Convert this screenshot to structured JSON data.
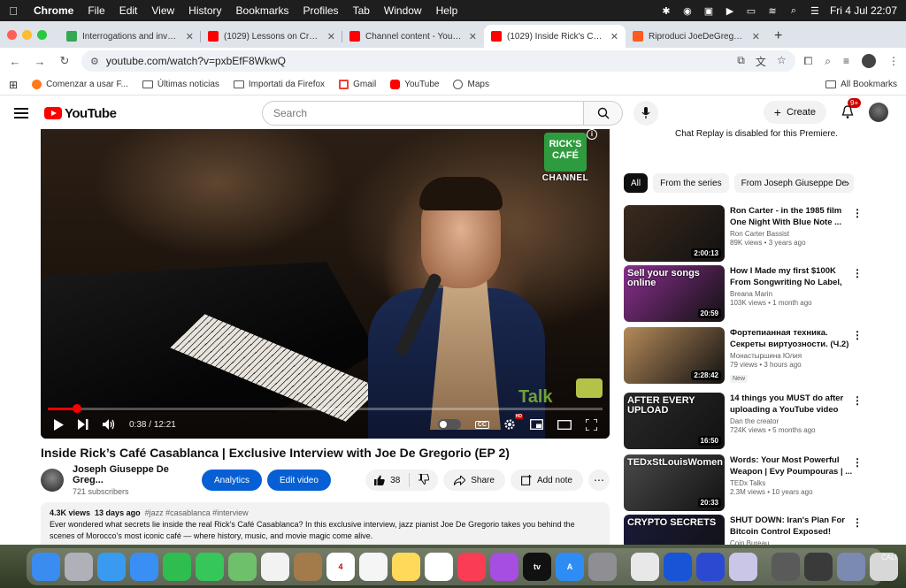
{
  "menubar": {
    "app": "Chrome",
    "items": [
      "File",
      "Edit",
      "View",
      "History",
      "Bookmarks",
      "Profiles",
      "Tab",
      "Window",
      "Help"
    ],
    "clock": "Fri 4 Jul  22:07"
  },
  "tabs": [
    {
      "title": "Interrogations and investigati",
      "favicon_color": "#34a853"
    },
    {
      "title": "(1029) Lessons on Creativity",
      "favicon_color": "#ff0000"
    },
    {
      "title": "Channel content - YouTube St",
      "favicon_color": "#ff0000"
    },
    {
      "title": "(1029) Inside Rick's Café Cas",
      "favicon_color": "#ff0000"
    },
    {
      "title": "Riproduci JoeDeGregorioMus",
      "favicon_color": "#ff5a1f"
    }
  ],
  "omnibox": {
    "url": "youtube.com/watch?v=pxbEfF8WkwQ"
  },
  "bookmarks": [
    {
      "label": "Comenzar a usar F...",
      "type": "firefox"
    },
    {
      "label": "Últimas noticias",
      "type": "folder"
    },
    {
      "label": "Importati da Firefox",
      "type": "folder"
    },
    {
      "label": "Gmail",
      "type": "gmail"
    },
    {
      "label": "YouTube",
      "type": "youtube"
    },
    {
      "label": "Maps",
      "type": "maps"
    }
  ],
  "bookmarks_all": "All Bookmarks",
  "youtube": {
    "logo": "YouTube",
    "search_placeholder": "Search",
    "create_label": "Create",
    "notif_count": "9+"
  },
  "player": {
    "channel_logo_line1": "RICK'S",
    "channel_logo_line2": "CAFÉ",
    "channel_logo_caption": "CHANNEL",
    "time_current": "0:38",
    "time_total": "12:21",
    "progress_fraction": 0.052,
    "talk_text": "Talk",
    "hd_badge": "HD"
  },
  "video": {
    "title": "Inside Rick’s Café Casablanca | Exclusive Interview with Joe De Gregorio (EP 2)",
    "channel": "Joseph Giuseppe De Greg...",
    "subscribers": "721 subscribers",
    "analytics_label": "Analytics",
    "edit_label": "Edit video",
    "likes": "38",
    "share_label": "Share",
    "note_label": "Add note",
    "views": "4.3K views",
    "ago": "13 days ago",
    "tags": "#jazz #casablanca #interview",
    "description_1": "Ever wondered what secrets lie inside the real Rick’s Café Casablanca? In this exclusive interview, jazz pianist Joe De Gregorio takes you behind the",
    "description_2": "scenes of Morocco’s most iconic café — where history, music, and movie magic come alive."
  },
  "sidebar": {
    "chat_note": "Chat Replay is disabled for this Premiere.",
    "chips": [
      "All",
      "From the series",
      "From Joseph Giuseppe De"
    ],
    "recs": [
      {
        "title": "Ron Carter - in the 1985 film One Night With Blue Note ...",
        "channel": "Ron Carter Bassist",
        "meta": "89K views • 3 years ago",
        "duration": "2:00:13",
        "thumb_color": "#3a2a1e",
        "thumb_text": "",
        "new": ""
      },
      {
        "title": "How I Made my first  $100K From Songwriting  No Label, N...",
        "channel": "Breana Marin",
        "meta": "103K views • 1 month ago",
        "duration": "20:59",
        "thumb_color": "#8a2f8f",
        "thumb_text": "Sell your songs online",
        "new": ""
      },
      {
        "title": "Фортепианная техника. Секреты виртуозности. (Ч.2)",
        "channel": "Монастыршина Юлия",
        "meta": "79 views • 3 hours ago",
        "duration": "2:28:42",
        "thumb_color": "#b58a5a",
        "thumb_text": "",
        "new": "New"
      },
      {
        "title": "14 things you MUST do after uploading a YouTube video",
        "channel": "Dan the creator",
        "meta": "724K views • 5 months ago",
        "duration": "16:50",
        "thumb_color": "#2a2a2a",
        "thumb_text": "AFTER EVERY UPLOAD",
        "new": ""
      },
      {
        "title": "Words: Your Most Powerful Weapon | Evy Poumpouras | ...",
        "channel": "TEDx Talks",
        "meta": "2.3M views • 10 years ago",
        "duration": "20:33",
        "thumb_color": "#4a4a4a",
        "thumb_text": "TEDxStLouisWomen",
        "new": ""
      },
      {
        "title": "SHUT DOWN: Iran's Plan For Bitcoin Control Exposed!",
        "channel": "Coin Bureau",
        "meta": "",
        "duration": "",
        "thumb_color": "#1a1a3a",
        "thumb_text": "CRYPTO SECRETS",
        "new": ""
      }
    ]
  },
  "dock": {
    "apps": [
      {
        "name": "finder",
        "color": "#3b8cf0",
        "label": ""
      },
      {
        "name": "launchpad",
        "color": "#b0b0b8",
        "label": ""
      },
      {
        "name": "safari",
        "color": "#3a9af0",
        "label": ""
      },
      {
        "name": "mail",
        "color": "#3a8ff5",
        "label": ""
      },
      {
        "name": "facetime",
        "color": "#2fbd4f",
        "label": ""
      },
      {
        "name": "messages",
        "color": "#35c759",
        "label": ""
      },
      {
        "name": "maps",
        "color": "#6ec16a",
        "label": ""
      },
      {
        "name": "photos",
        "color": "#f2f2f2",
        "label": ""
      },
      {
        "name": "notes-brown",
        "color": "#a37b4a",
        "label": ""
      },
      {
        "name": "calendar",
        "color": "#ffffff",
        "label": "4"
      },
      {
        "name": "reminders",
        "color": "#f5f5f5",
        "label": ""
      },
      {
        "name": "notes",
        "color": "#ffd95a",
        "label": ""
      },
      {
        "name": "freeform",
        "color": "#ffffff",
        "label": ""
      },
      {
        "name": "music",
        "color": "#fa3c55",
        "label": ""
      },
      {
        "name": "podcasts",
        "color": "#a64ee0",
        "label": ""
      },
      {
        "name": "tv",
        "color": "#111111",
        "label": "tv"
      },
      {
        "name": "app-store",
        "color": "#2e8df5",
        "label": "A"
      },
      {
        "name": "settings",
        "color": "#8e8e93",
        "label": ""
      },
      {
        "name": "chrome",
        "color": "#e8e8e8",
        "label": ""
      },
      {
        "name": "app-blue",
        "color": "#1755d6",
        "label": ""
      },
      {
        "name": "headphones-app",
        "color": "#2b4ad1",
        "label": ""
      },
      {
        "name": "app-purple",
        "color": "#c9c6e8",
        "label": ""
      },
      {
        "name": "window-1",
        "color": "#5a5a5a",
        "label": ""
      },
      {
        "name": "window-2",
        "color": "#3a3a3a",
        "label": ""
      },
      {
        "name": "window-3",
        "color": "#7a8ab0",
        "label": ""
      },
      {
        "name": "trash",
        "color": "#d8d8d8",
        "label": ""
      }
    ],
    "right_text": "CALI"
  }
}
